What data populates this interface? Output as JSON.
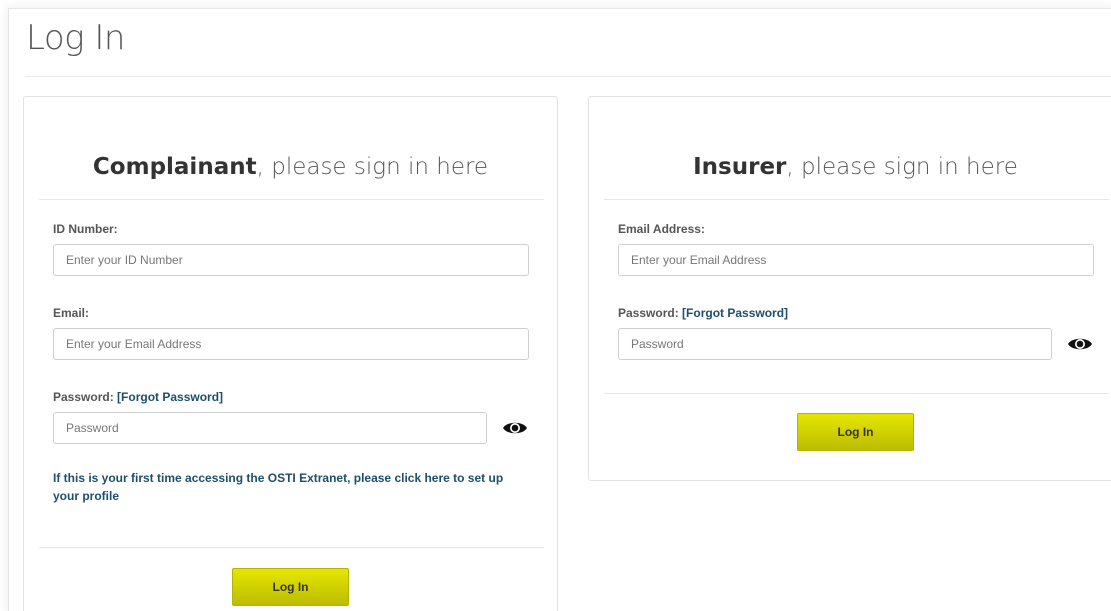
{
  "page": {
    "title": "Log In"
  },
  "complainant": {
    "heading_bold": "Complainant",
    "heading_rest": ", please sign in here",
    "id_label": "ID Number:",
    "id_placeholder": "Enter your ID Number",
    "email_label": "Email:",
    "email_placeholder": "Enter your Email Address",
    "password_label": "Password: ",
    "forgot_link": "[Forgot Password]",
    "password_placeholder": "Password",
    "first_time_text": "If this is your first time accessing the OSTI Extranet, please click here to set up your profile",
    "login_label": "Log In"
  },
  "insurer": {
    "heading_bold": "Insurer",
    "heading_rest": ", please sign in here",
    "email_label": "Email Address:",
    "email_placeholder": "Enter your Email Address",
    "password_label": "Password: ",
    "forgot_link": "[Forgot Password]",
    "password_placeholder": "Password",
    "login_label": "Log In"
  },
  "colors": {
    "button_top": "#e6e600",
    "button_bottom": "#bcbc00",
    "link": "#1d4e6a"
  },
  "icons": {
    "show_password": "eye-icon"
  }
}
